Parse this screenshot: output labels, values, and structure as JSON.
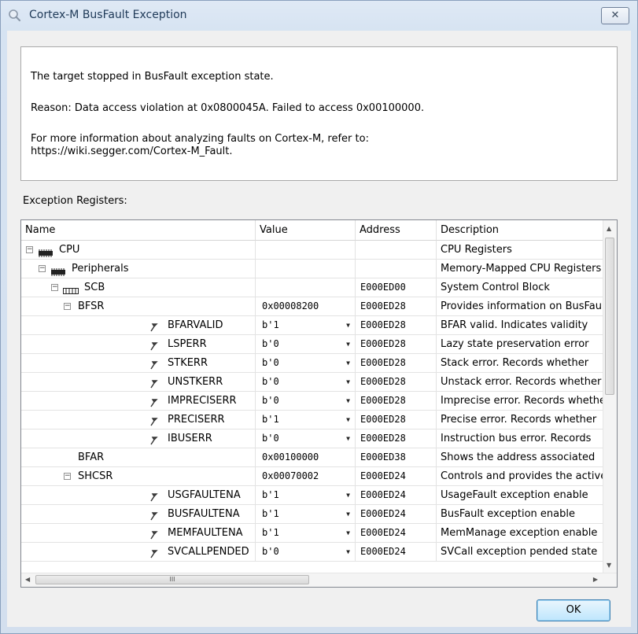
{
  "window": {
    "title": "Cortex-M BusFault Exception",
    "close_label": "✕"
  },
  "message": {
    "line1": "The target stopped in BusFault exception state.",
    "line2": "Reason: Data access violation at 0x0800045A. Failed to access 0x00100000.",
    "line3": "For more information about analyzing faults on Cortex-M, refer to:\nhttps://wiki.segger.com/Cortex-M_Fault."
  },
  "section_label": "Exception Registers:",
  "columns": [
    "Name",
    "Value",
    "Address",
    "Description"
  ],
  "rows": [
    {
      "name": "CPU",
      "level": 0,
      "expander": "−",
      "icon": "chip-icon",
      "value": "",
      "dropdown": false,
      "address": "",
      "description": "CPU Registers"
    },
    {
      "name": "Peripherals",
      "level": 1,
      "expander": "−",
      "icon": "chip-icon",
      "value": "",
      "dropdown": false,
      "address": "",
      "description": "Memory-Mapped CPU Registers"
    },
    {
      "name": "SCB",
      "level": 2,
      "expander": "−",
      "icon": "register-block-icon",
      "value": "",
      "dropdown": false,
      "address": "E000ED00",
      "description": "System Control Block"
    },
    {
      "name": "BFSR",
      "level": 3,
      "expander": "−",
      "icon": "",
      "value": "0x00008200",
      "dropdown": false,
      "address": "E000ED28",
      "description": "Provides information on BusFault"
    },
    {
      "name": "BFARVALID",
      "level": 4,
      "expander": "",
      "icon": "bitfield-icon",
      "value": "b'1",
      "dropdown": true,
      "address": "E000ED28",
      "description": "BFAR valid. Indicates validity"
    },
    {
      "name": "LSPERR",
      "level": 4,
      "expander": "",
      "icon": "bitfield-icon",
      "value": "b'0",
      "dropdown": true,
      "address": "E000ED28",
      "description": "Lazy state preservation error"
    },
    {
      "name": "STKERR",
      "level": 4,
      "expander": "",
      "icon": "bitfield-icon",
      "value": "b'0",
      "dropdown": true,
      "address": "E000ED28",
      "description": "Stack error. Records whether"
    },
    {
      "name": "UNSTKERR",
      "level": 4,
      "expander": "",
      "icon": "bitfield-icon",
      "value": "b'0",
      "dropdown": true,
      "address": "E000ED28",
      "description": "Unstack error. Records whether"
    },
    {
      "name": "IMPRECISERR",
      "level": 4,
      "expander": "",
      "icon": "bitfield-icon",
      "value": "b'0",
      "dropdown": true,
      "address": "E000ED28",
      "description": "Imprecise error. Records whether"
    },
    {
      "name": "PRECISERR",
      "level": 4,
      "expander": "",
      "icon": "bitfield-icon",
      "value": "b'1",
      "dropdown": true,
      "address": "E000ED28",
      "description": "Precise error. Records whether"
    },
    {
      "name": "IBUSERR",
      "level": 4,
      "expander": "",
      "icon": "bitfield-icon",
      "value": "b'0",
      "dropdown": true,
      "address": "E000ED28",
      "description": "Instruction bus error. Records"
    },
    {
      "name": "BFAR",
      "level": 3,
      "expander": "",
      "icon": "",
      "value": "0x00100000",
      "dropdown": false,
      "address": "E000ED38",
      "description": "Shows the address associated"
    },
    {
      "name": "SHCSR",
      "level": 3,
      "expander": "−",
      "icon": "",
      "value": "0x00070002",
      "dropdown": false,
      "address": "E000ED24",
      "description": "Controls and provides the active"
    },
    {
      "name": "USGFAULTENA",
      "level": 4,
      "expander": "",
      "icon": "bitfield-icon",
      "value": "b'1",
      "dropdown": true,
      "address": "E000ED24",
      "description": "UsageFault exception enable"
    },
    {
      "name": "BUSFAULTENA",
      "level": 4,
      "expander": "",
      "icon": "bitfield-icon",
      "value": "b'1",
      "dropdown": true,
      "address": "E000ED24",
      "description": "BusFault exception enable"
    },
    {
      "name": "MEMFAULTENA",
      "level": 4,
      "expander": "",
      "icon": "bitfield-icon",
      "value": "b'1",
      "dropdown": true,
      "address": "E000ED24",
      "description": "MemManage exception enable"
    },
    {
      "name": "SVCALLPENDED",
      "level": 4,
      "expander": "",
      "icon": "bitfield-icon",
      "value": "b'0",
      "dropdown": true,
      "address": "E000ED24",
      "description": "SVCall exception pended state"
    }
  ],
  "buttons": {
    "ok_label": "OK"
  },
  "scroll": {
    "horizontal_grip": "III"
  },
  "colors": {
    "title_text": "#1e3957",
    "button_border": "#3c7fb1"
  }
}
